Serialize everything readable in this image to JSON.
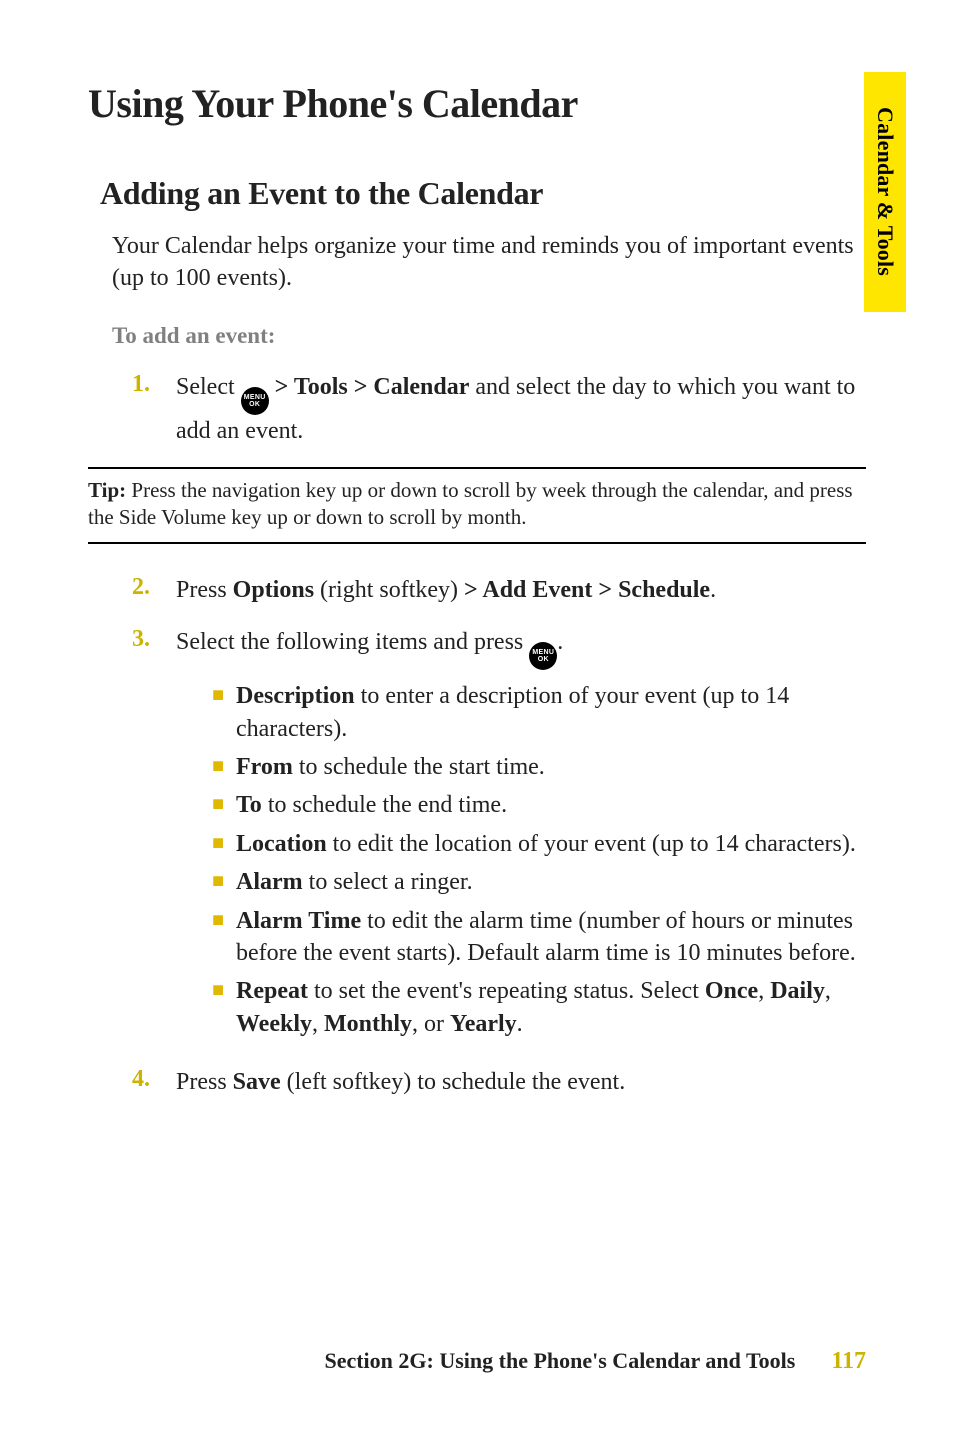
{
  "sideTab": "Calendar & Tools",
  "title": "Using Your Phone's Calendar",
  "h2": "Adding an Event to the Calendar",
  "intro": "Your Calendar helps organize your time and reminds you of important events (up to 100 events).",
  "subhead": "To add an event:",
  "step1_num": "1.",
  "step1_pre": "Select ",
  "step1_boldA": " > Tools > Calendar",
  "step1_post": " and select the day to which you want to add an event.",
  "tip_label": "Tip:",
  "tip_text": " Press the navigation key up or down to scroll by week through the calendar, and press the Side Volume key up or down to scroll by month.",
  "step2_num": "2.",
  "step2_pre": "Press ",
  "step2_b1": "Options",
  "step2_mid": " (right softkey) ",
  "step2_b2": "> Add Event > Schedule",
  "step2_post": ".",
  "step3_num": "3.",
  "step3_text": "Select the following items and press ",
  "step3_post": ".",
  "bullets": {
    "b1_bold": "Description",
    "b1_rest": " to enter a description of your event (up to 14 characters).",
    "b2_bold": "From",
    "b2_rest": " to schedule the start time.",
    "b3_bold": "To",
    "b3_rest": " to schedule the end time.",
    "b4_bold": "Location",
    "b4_rest": " to edit the location of your event (up to 14 characters).",
    "b5_bold": "Alarm",
    "b5_rest": " to select a ringer.",
    "b6_bold": "Alarm Time",
    "b6_rest": " to edit the alarm time (number of hours or minutes before the event starts). Default alarm time is 10 minutes before.",
    "b7_bold": "Repeat",
    "b7_rest_a": " to set the event's repeating status. Select ",
    "b7_once": "Once",
    "b7_c1": ", ",
    "b7_daily": "Daily",
    "b7_c2": ", ",
    "b7_weekly": "Weekly",
    "b7_c3": ", ",
    "b7_monthly": "Monthly",
    "b7_c4": ", or ",
    "b7_yearly": "Yearly",
    "b7_c5": "."
  },
  "step4_num": "4.",
  "step4_pre": "Press ",
  "step4_bold": "Save",
  "step4_post": " (left softkey) to schedule the event.",
  "footerTitle": "Section 2G: Using the Phone's Calendar and Tools",
  "footerPage": "117",
  "iconTop": "MENU",
  "iconBot": "OK"
}
